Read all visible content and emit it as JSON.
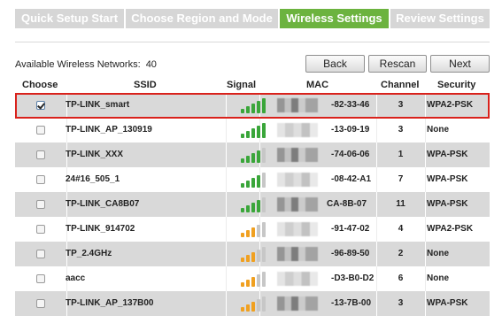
{
  "wizard_tabs": [
    {
      "label": "Quick Setup Start",
      "active": false
    },
    {
      "label": "Choose Region and Mode",
      "active": false
    },
    {
      "label": "Wireless Settings",
      "active": true
    },
    {
      "label": "Review Settings",
      "active": false
    }
  ],
  "colors": {
    "active_tab": "#6cb33f",
    "inactive_tab": "#d6d6d6",
    "signal_strong": "#3aa63a",
    "signal_medium": "#f0a020",
    "highlight": "#d9221c"
  },
  "networks_count_label": "Available Wireless Networks:",
  "networks_count": "40",
  "buttons": {
    "back": "Back",
    "rescan": "Rescan",
    "next": "Next"
  },
  "table": {
    "headers": [
      "Choose",
      "SSID",
      "Signal",
      "MAC",
      "Channel",
      "Security"
    ],
    "rows": [
      {
        "checked": true,
        "ssid": "TP-LINK_smart",
        "signal_bars": 5,
        "signal_color": "green",
        "mac": "-82-33-46",
        "channel": "3",
        "security": "WPA2-PSK"
      },
      {
        "checked": false,
        "ssid": "TP-LINK_AP_130919",
        "signal_bars": 5,
        "signal_color": "green",
        "mac": "-13-09-19",
        "channel": "3",
        "security": "None"
      },
      {
        "checked": false,
        "ssid": "TP-LINK_XXX",
        "signal_bars": 4,
        "signal_color": "green",
        "mac": "-74-06-06",
        "channel": "1",
        "security": "WPA-PSK"
      },
      {
        "checked": false,
        "ssid": "24#16_505_1",
        "signal_bars": 4,
        "signal_color": "green",
        "mac": "-08-42-A1",
        "channel": "7",
        "security": "WPA-PSK"
      },
      {
        "checked": false,
        "ssid": "TP-LINK_CA8B07",
        "signal_bars": 4,
        "signal_color": "green",
        "mac": "CA-8B-07",
        "channel": "11",
        "security": "WPA-PSK"
      },
      {
        "checked": false,
        "ssid": "TP-LINK_914702",
        "signal_bars": 3,
        "signal_color": "orange",
        "mac": "-91-47-02",
        "channel": "4",
        "security": "WPA2-PSK"
      },
      {
        "checked": false,
        "ssid": "TP_2.4GHz",
        "signal_bars": 3,
        "signal_color": "orange",
        "mac": "-96-89-50",
        "channel": "2",
        "security": "None"
      },
      {
        "checked": false,
        "ssid": "aacc",
        "signal_bars": 3,
        "signal_color": "orange",
        "mac": "-D3-B0-D2",
        "channel": "6",
        "security": "None"
      },
      {
        "checked": false,
        "ssid": "TP-LINK_AP_137B00",
        "signal_bars": 3,
        "signal_color": "orange",
        "mac": "-13-7B-00",
        "channel": "3",
        "security": "WPA-PSK"
      }
    ]
  }
}
